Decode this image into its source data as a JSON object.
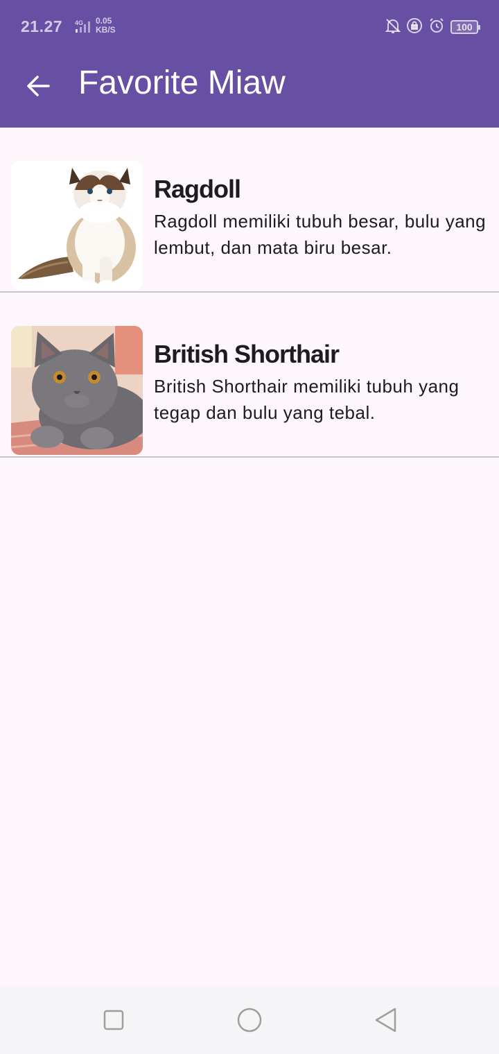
{
  "status_bar": {
    "time": "21.27",
    "network": "4G",
    "speed_value": "0.05",
    "speed_unit": "KB/S",
    "battery": "100",
    "icons": [
      "bell-off-icon",
      "lock-rotation-icon",
      "alarm-icon",
      "battery-icon"
    ]
  },
  "app_bar": {
    "title": "Favorite Miaw",
    "back_icon": "arrow-left-icon",
    "background": "#6750a4"
  },
  "favorites": [
    {
      "name": "Ragdoll",
      "description": "Ragdoll memiliki tubuh besar, bulu yang lembut, dan mata biru besar.",
      "image": "ragdoll-cat-photo"
    },
    {
      "name": "British Shorthair",
      "description": "British Shorthair memiliki tubuh yang tegap dan bulu yang tebal.",
      "image": "british-shorthair-cat-photo"
    }
  ],
  "nav_bar": {
    "buttons": [
      "recents-square-icon",
      "home-circle-icon",
      "back-triangle-icon"
    ]
  }
}
